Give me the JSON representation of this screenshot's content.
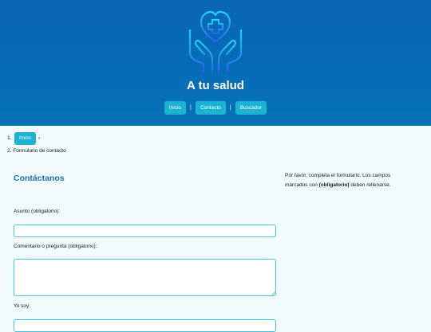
{
  "header": {
    "site_title": "A tu salud",
    "logo_icon": "hands-heart-cross-icon",
    "nav": [
      "Inicio",
      "Contacto",
      "Buscador"
    ],
    "nav_separator": "|"
  },
  "breadcrumb": {
    "items": [
      {
        "num": "1.",
        "label": "Inicio",
        "chevron": "›"
      },
      {
        "num": "2.",
        "label": "Formulario de contacto"
      }
    ]
  },
  "form": {
    "title": "Contáctanos",
    "fields": [
      {
        "label": "Asunto (obligatorio):",
        "value": ""
      },
      {
        "label": "Comentario o pregunta (obligatorio):",
        "value": ""
      },
      {
        "label": "Yo soy:",
        "value": ""
      }
    ]
  },
  "aside": {
    "text_before": "Por favor, completa el formulario. Los campos marcados con ",
    "bold": "(obligatorio)",
    "text_after": " deben rellenarse."
  },
  "colors": {
    "header": "#0a66b7",
    "accent": "#1cb3d3",
    "title": "#1a6fb5",
    "field_border": "#49c3dc"
  }
}
